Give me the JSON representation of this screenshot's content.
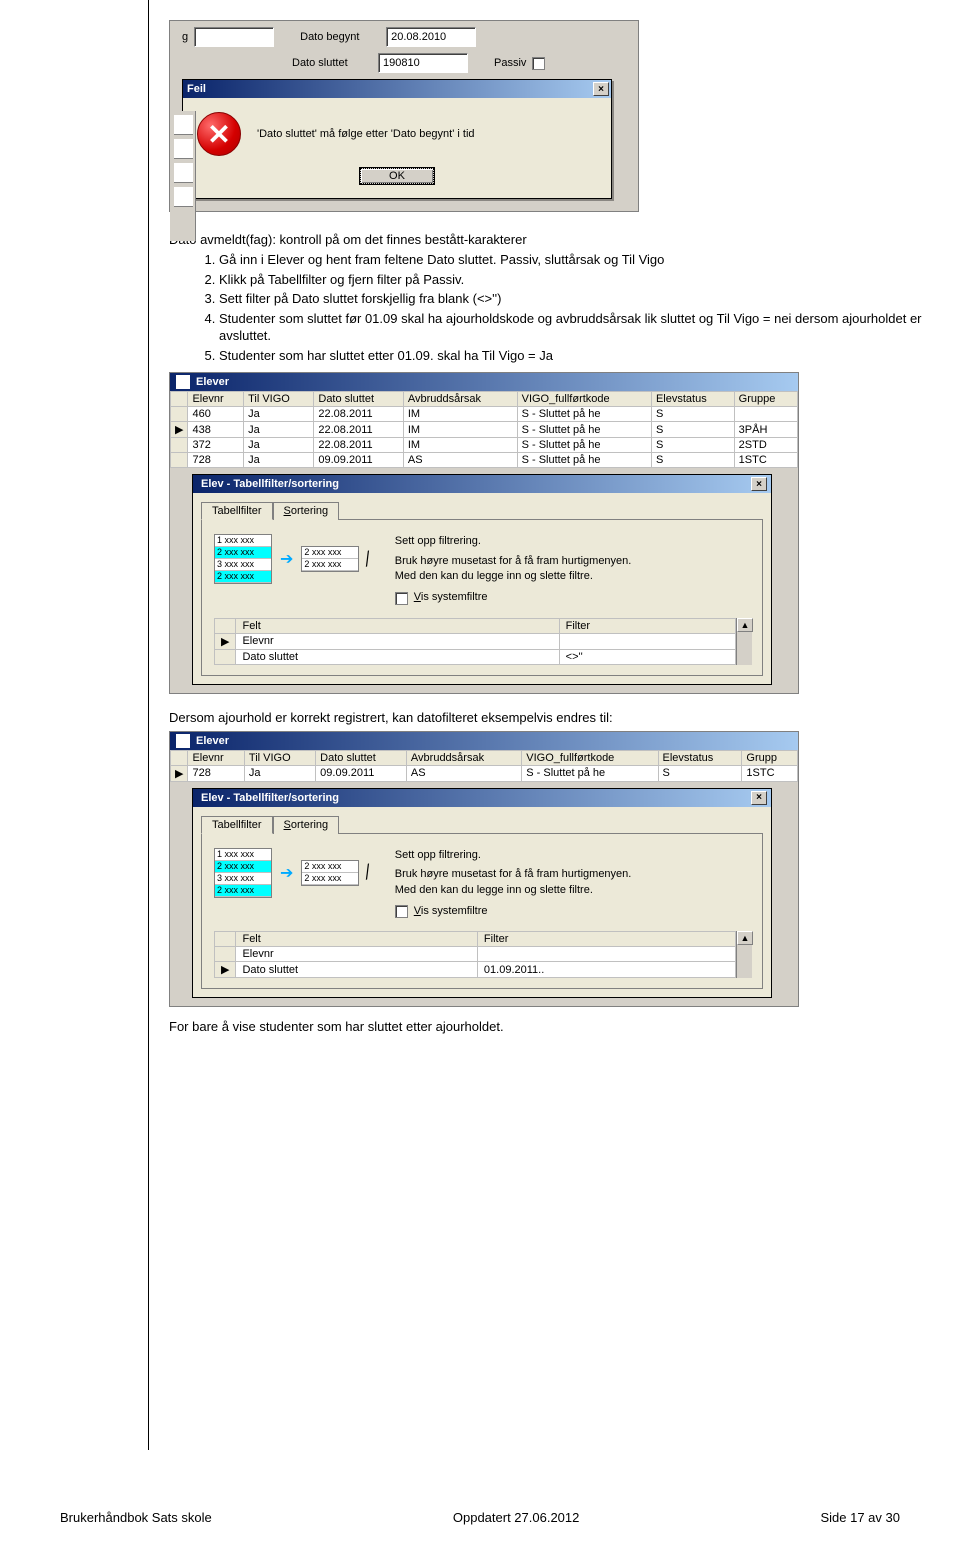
{
  "ss1": {
    "field_g_label": "g",
    "field_dato_begynt_label": "Dato begynt",
    "field_dato_begynt_value": "20.08.2010",
    "field_dato_sluttet_label": "Dato sluttet",
    "field_dato_sluttet_value": "190810",
    "field_passiv_label": "Passiv",
    "error_title": "Feil",
    "error_msg": "'Dato sluttet' må følge etter 'Dato begynt' i tid",
    "error_ok": "OK"
  },
  "intro": "Dato avmeldt(fag): kontroll på om det finnes bestått-karakterer",
  "steps": [
    "Gå inn i Elever og hent fram feltene Dato sluttet. Passiv, sluttårsak og Til Vigo",
    "Klikk på Tabellfilter og fjern filter på Passiv.",
    "Sett filter på Dato sluttet forskjellig fra blank (<>'')",
    "Studenter som sluttet før 01.09 skal ha ajourholdskode og avbruddsårsak lik sluttet og Til Vigo = nei dersom ajourholdet er avsluttet.",
    "Studenter som har sluttet etter 01.09. skal ha Til Vigo = Ja"
  ],
  "elever": {
    "title": "Elever",
    "columns": [
      "Elevnr",
      "Til VIGO",
      "Dato sluttet",
      "Avbruddsårsak",
      "VIGO_fullførtkode",
      "Elevstatus",
      "Gruppe"
    ],
    "rows": [
      [
        "460",
        "Ja",
        "22.08.2011",
        "IM",
        "S - Sluttet på he",
        "S",
        ""
      ],
      [
        "438",
        "Ja",
        "22.08.2011",
        "IM",
        "S - Sluttet på he",
        "S",
        "3PÅH"
      ],
      [
        "372",
        "Ja",
        "22.08.2011",
        "IM",
        "S - Sluttet på he",
        "S",
        "2STD"
      ],
      [
        "728",
        "Ja",
        "09.09.2011",
        "AS",
        "S - Sluttet på he",
        "S",
        "1STC"
      ]
    ]
  },
  "filter_dialog": {
    "title": "Elev - Tabellfilter/sortering",
    "tab1": "Tabellfilter",
    "tab2": "Sortering",
    "hint_title": "Sett opp filtrering.",
    "hint_body": "Bruk høyre musetast for å få fram hurtigmenyen.\nMed den kan du legge inn og slette filtre.",
    "vis_label": "Vis systemfiltre",
    "grid_headers": [
      "Felt",
      "Filter"
    ],
    "grid_rows_a": [
      [
        "Elevnr",
        ""
      ],
      [
        "Dato sluttet",
        "<>''"
      ]
    ],
    "grid_rows_b": [
      [
        "Elevnr",
        ""
      ],
      [
        "Dato sluttet",
        "01.09.2011.."
      ]
    ],
    "mini_left": [
      "1 xxx xxx",
      "2 xxx xxx",
      "3 xxx xxx",
      "2 xxx xxx"
    ],
    "mini_right": [
      "2 xxx xxx",
      "2 xxx xxx"
    ]
  },
  "elever2": {
    "title": "Elever",
    "columns": [
      "Elevnr",
      "Til VIGO",
      "Dato sluttet",
      "Avbruddsårsak",
      "VIGO_fullførtkode",
      "Elevstatus",
      "Grupp"
    ],
    "rows": [
      [
        "728",
        "Ja",
        "09.09.2011",
        "AS",
        "S - Sluttet på he",
        "S",
        "1STC"
      ]
    ]
  },
  "para_mid": "Dersom ajourhold er korrekt registrert, kan datofilteret eksempelvis endres til:",
  "para_end": "For bare å vise studenter som har sluttet etter ajourholdet.",
  "footer": {
    "left": "Brukerhåndbok Sats skole",
    "mid": "Oppdatert  27.06.2012",
    "right": "Side 17 av 30"
  }
}
